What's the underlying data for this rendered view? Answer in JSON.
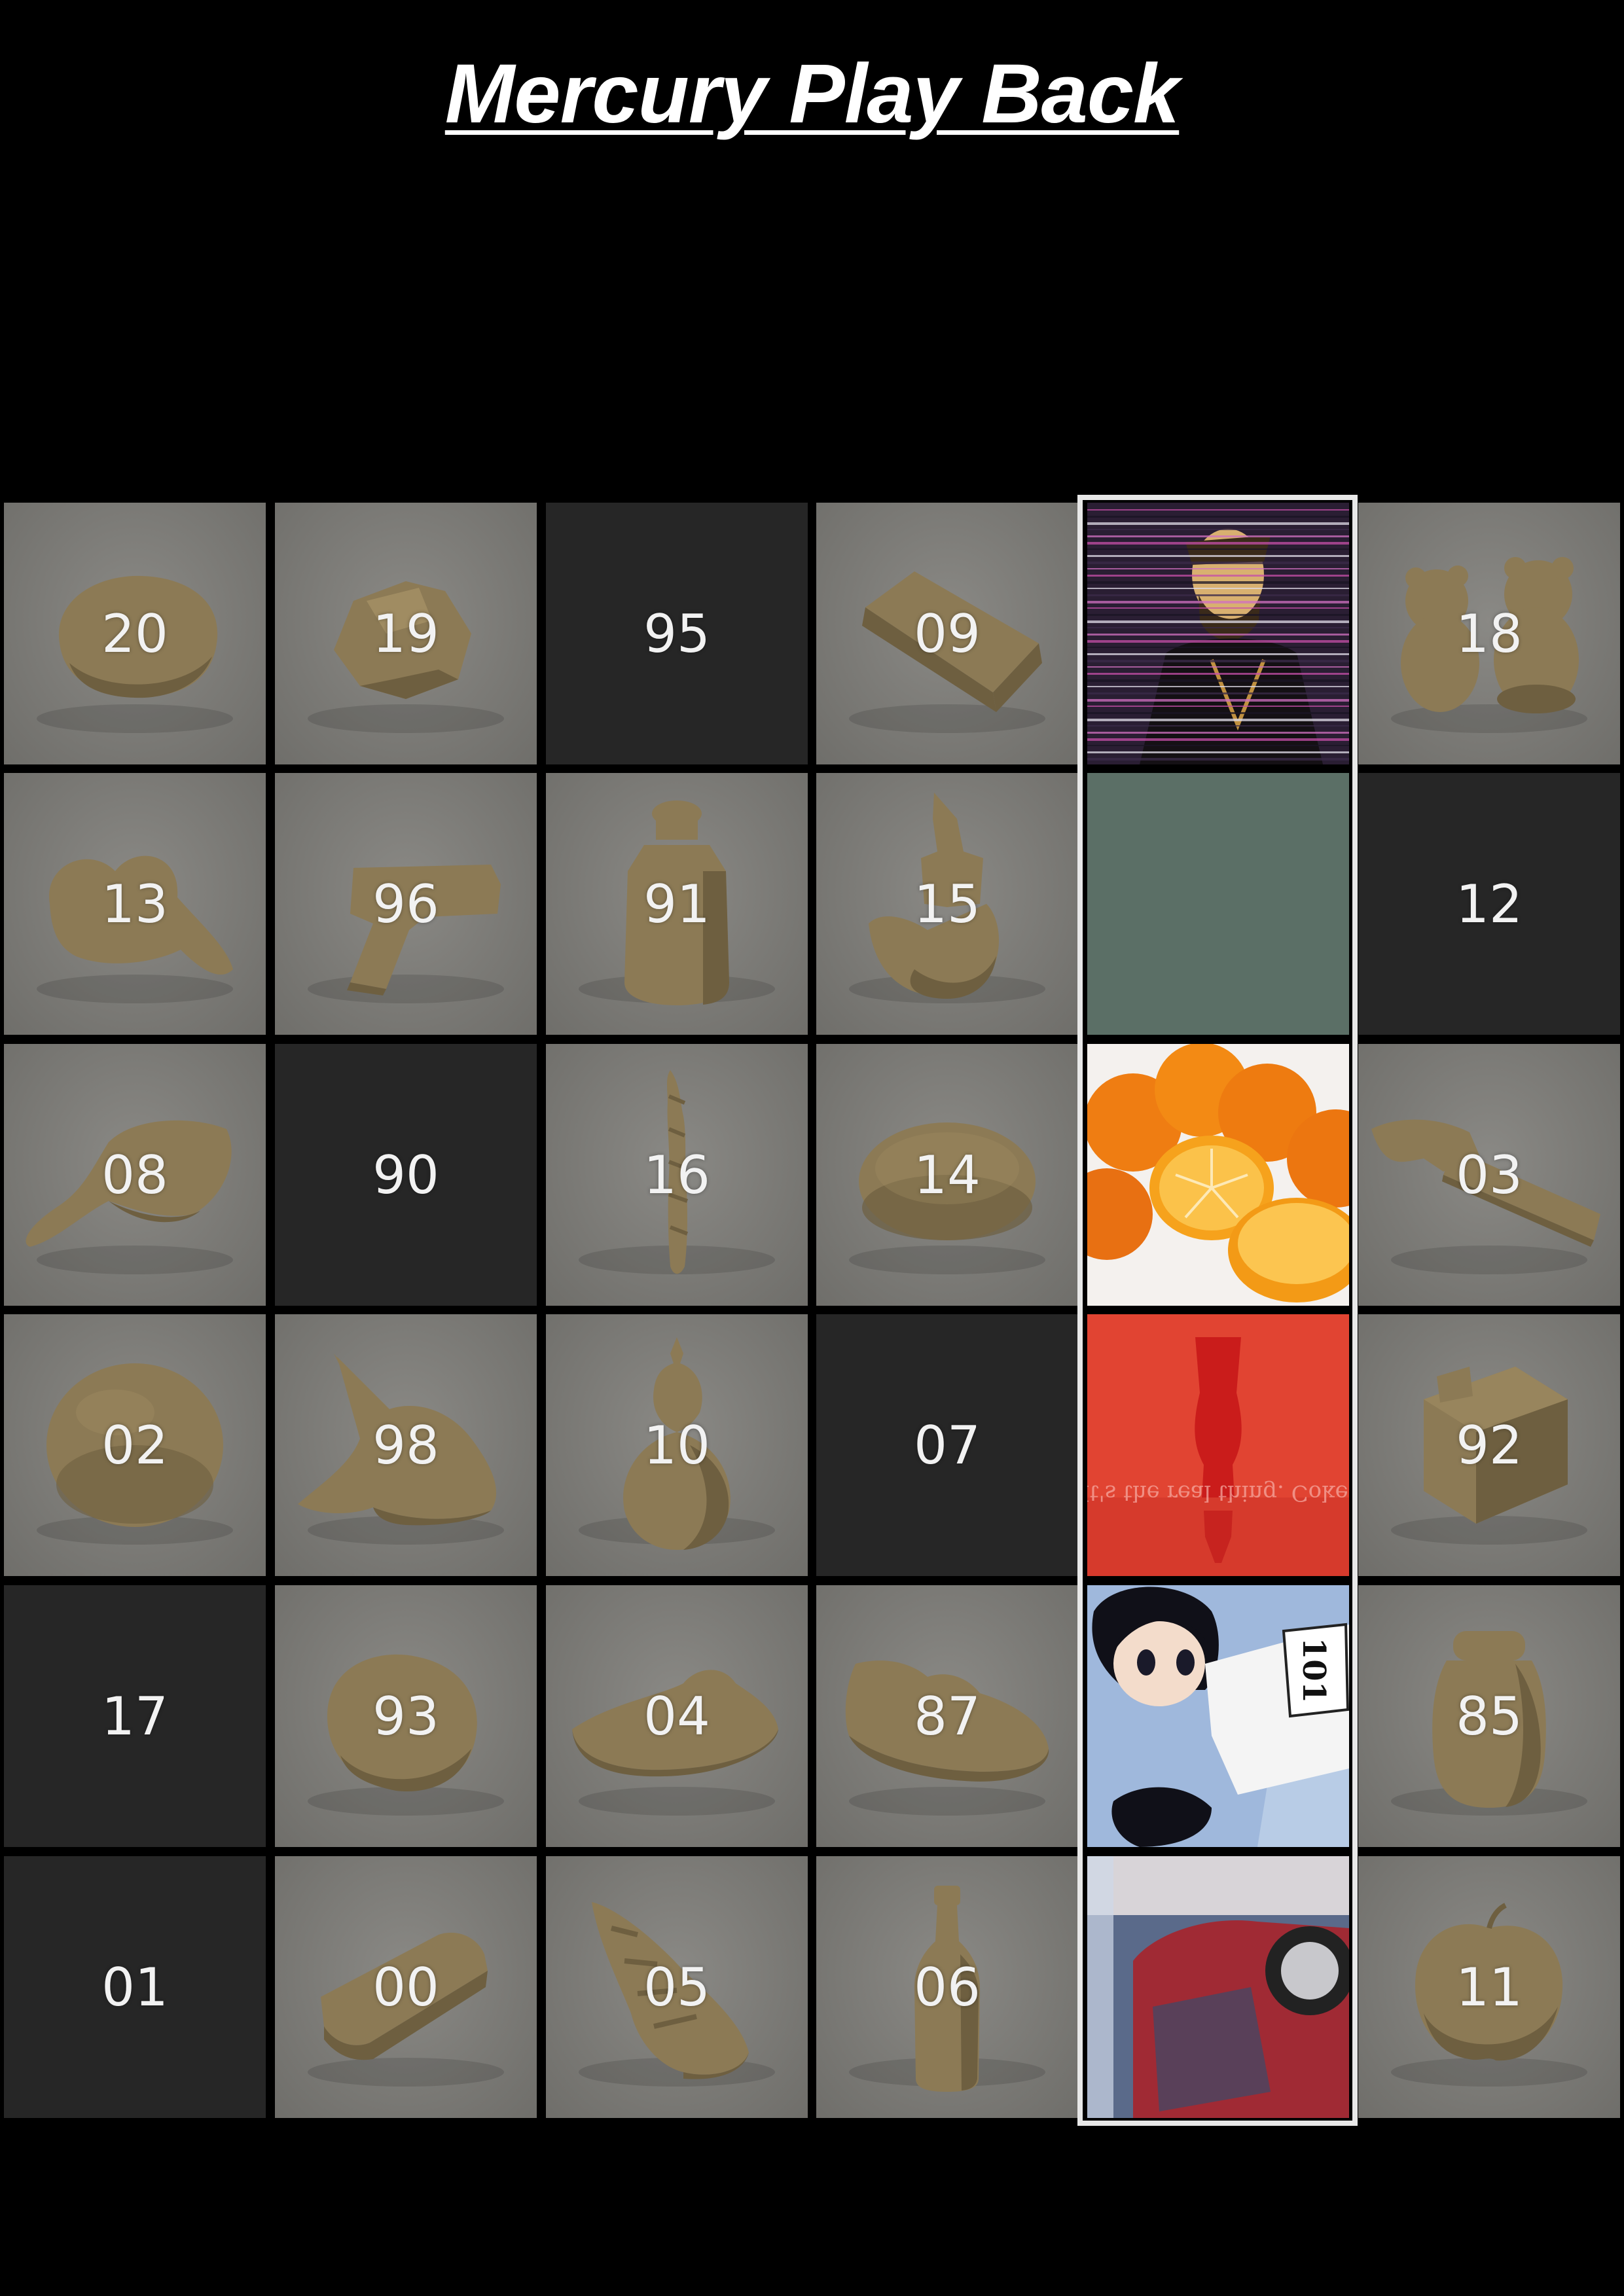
{
  "title": "Mercury Play Back",
  "colors": {
    "background": "#000000",
    "tile_object": "#7b7a76",
    "tile_dark": "#262626",
    "highlight": "#e8e8e8",
    "clay": "#8c7a55"
  },
  "grid": {
    "rows": [
      [
        {
          "label": "20",
          "kind": "object",
          "icon": "clay-lump-icon"
        },
        {
          "label": "19",
          "kind": "object",
          "icon": "clay-crumpled-can-icon"
        },
        {
          "label": "95",
          "kind": "empty"
        },
        {
          "label": "09",
          "kind": "object",
          "icon": "clay-tablet-icon"
        },
        {
          "label": "",
          "kind": "image",
          "icon": "anime-glitch-image"
        },
        {
          "label": "18",
          "kind": "object",
          "icon": "clay-teddy-bears-icon"
        }
      ],
      [
        {
          "label": "13",
          "kind": "object",
          "icon": "clay-heart-blob-icon"
        },
        {
          "label": "96",
          "kind": "object",
          "icon": "clay-pistol-icon"
        },
        {
          "label": "91",
          "kind": "object",
          "icon": "clay-milk-bottle-icon"
        },
        {
          "label": "15",
          "kind": "object",
          "icon": "clay-duck-lantern-icon"
        },
        {
          "label": "",
          "kind": "image",
          "icon": "solid-green-image"
        },
        {
          "label": "12",
          "kind": "empty"
        }
      ],
      [
        {
          "label": "08",
          "kind": "object",
          "icon": "clay-leaf-blob-icon"
        },
        {
          "label": "90",
          "kind": "empty"
        },
        {
          "label": "16",
          "kind": "object",
          "icon": "clay-twisted-stick-icon"
        },
        {
          "label": "14",
          "kind": "object",
          "icon": "clay-donut-icon"
        },
        {
          "label": "",
          "kind": "image",
          "icon": "oranges-photo-image"
        },
        {
          "label": "03",
          "kind": "object",
          "icon": "clay-hammer-icon"
        }
      ],
      [
        {
          "label": "02",
          "kind": "object",
          "icon": "clay-ball-icon"
        },
        {
          "label": "98",
          "kind": "object",
          "icon": "clay-spiky-blob-icon"
        },
        {
          "label": "10",
          "kind": "object",
          "icon": "clay-gourd-icon"
        },
        {
          "label": "07",
          "kind": "empty"
        },
        {
          "label": "",
          "kind": "image",
          "icon": "coke-bottle-ad-image",
          "text": "It's the real thing. Coke."
        },
        {
          "label": "92",
          "kind": "object",
          "icon": "clay-cube-icon"
        }
      ],
      [
        {
          "label": "17",
          "kind": "empty"
        },
        {
          "label": "93",
          "kind": "object",
          "icon": "clay-round-lump-icon"
        },
        {
          "label": "04",
          "kind": "object",
          "icon": "clay-slipper-icon"
        },
        {
          "label": "87",
          "kind": "object",
          "icon": "clay-sneaker-icon"
        },
        {
          "label": "",
          "kind": "image",
          "icon": "anime-runner-image",
          "text": "101"
        },
        {
          "label": "85",
          "kind": "object",
          "icon": "clay-jar-icon"
        }
      ],
      [
        {
          "label": "01",
          "kind": "empty"
        },
        {
          "label": "00",
          "kind": "object",
          "icon": "clay-soap-bar-icon"
        },
        {
          "label": "05",
          "kind": "object",
          "icon": "clay-seashell-icon"
        },
        {
          "label": "06",
          "kind": "object",
          "icon": "clay-bottle-icon"
        },
        {
          "label": "",
          "kind": "image",
          "icon": "car-advert-image"
        },
        {
          "label": "11",
          "kind": "object",
          "icon": "clay-apple-icon"
        }
      ]
    ]
  }
}
